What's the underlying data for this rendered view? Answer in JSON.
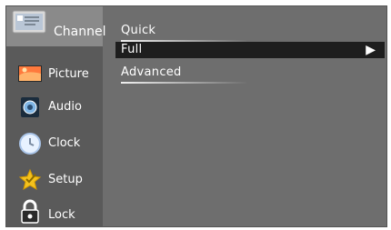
{
  "sidebar": {
    "items": [
      {
        "label": "Channel",
        "icon": "channel-icon",
        "selected": true
      },
      {
        "label": "Picture",
        "icon": "picture-icon"
      },
      {
        "label": "Audio",
        "icon": "audio-icon"
      },
      {
        "label": "Clock",
        "icon": "clock-icon"
      },
      {
        "label": "Setup",
        "icon": "setup-icon"
      },
      {
        "label": "Lock",
        "icon": "lock-icon"
      }
    ]
  },
  "main": {
    "options": [
      {
        "label": "Quick"
      },
      {
        "label": "Full",
        "selected": true,
        "arrow": "▶"
      },
      {
        "label": "Advanced"
      }
    ]
  },
  "colors": {
    "background": "#6e6e6e",
    "sidebar": "#5a5a5a",
    "selected_sidebar": "#8a8a8a",
    "selected_option": "#1e1e1e",
    "text": "#ffffff"
  }
}
